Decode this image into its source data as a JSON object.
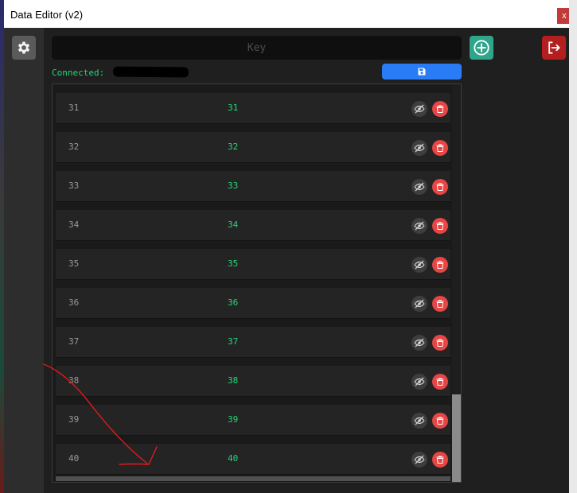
{
  "window": {
    "title": "Data Editor (v2)",
    "close_label": "x"
  },
  "search": {
    "placeholder": "Key",
    "value": ""
  },
  "status": {
    "connected_label": "Connected:"
  },
  "scroll": {
    "vertical_position": 1.0,
    "visible_fraction": 0.22
  },
  "colors": {
    "accent_blue": "#2a7cf6",
    "accent_teal": "#2fa58b",
    "danger": "#e84545",
    "value_green": "#29d479"
  },
  "icons": {
    "settings": "gear-icon",
    "add": "plus-circle-icon",
    "exit": "logout-icon",
    "save": "floppy-disk-icon",
    "toggle": "eye-slash-icon",
    "delete": "trash-icon"
  },
  "rows": [
    {
      "key": "31",
      "value": "31"
    },
    {
      "key": "32",
      "value": "32"
    },
    {
      "key": "33",
      "value": "33"
    },
    {
      "key": "34",
      "value": "34"
    },
    {
      "key": "35",
      "value": "35"
    },
    {
      "key": "36",
      "value": "36"
    },
    {
      "key": "37",
      "value": "37"
    },
    {
      "key": "38",
      "value": "38"
    },
    {
      "key": "39",
      "value": "39"
    },
    {
      "key": "40",
      "value": "40"
    }
  ]
}
